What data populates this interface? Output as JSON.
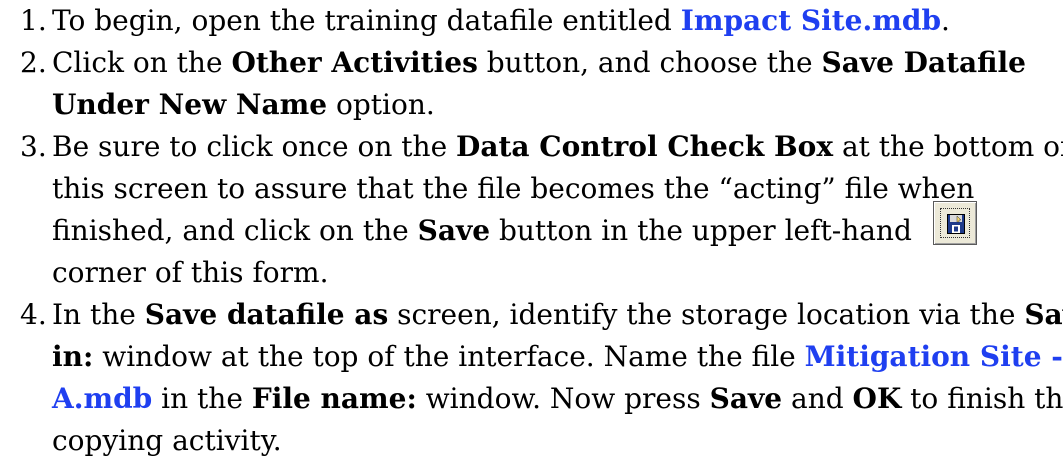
{
  "steps": [
    {
      "num": "1.",
      "lines": [
        {
          "t1": "To begin, open the training datafile entitled ",
          "link1": "Impact Site.mdb",
          "t2": "."
        }
      ]
    },
    {
      "num": "2.",
      "l1": {
        "t1": "Click on the ",
        "b1": "Other Activities",
        "t2": " button, and choose the ",
        "b2": "Save Datafile"
      },
      "l2": {
        "b1": "Under New Name",
        "t1": " option."
      }
    },
    {
      "num": "3.",
      "l1": {
        "t1": "Be sure to click once on the ",
        "b1": "Data Control Check Box",
        "t2": " at the bottom of"
      },
      "l2": {
        "t1": "this screen to assure that the file becomes the “acting” file when"
      },
      "l3": {
        "t1": "finished, and click on the ",
        "b1": "Save",
        "t2": " button in the upper left-hand"
      },
      "l4": {
        "t1": "corner of this form."
      }
    },
    {
      "num": "4.",
      "l1": {
        "t1": "In the ",
        "b1": "Save datafile as",
        "t2": " screen, identify the storage location via the ",
        "b2": "Save"
      },
      "l2": {
        "b1": "in:",
        "t1": " window at the top of the interface. Name the file ",
        "link1": "Mitigation Site -"
      },
      "l3": {
        "link1": "A.mdb",
        "t1": " in the ",
        "b1": "File name:",
        "t2": " window. Now press ",
        "b2": "Save",
        "t3": " and ",
        "b3": "OK",
        "t4": " to finish the"
      },
      "l4": {
        "t1": "copying activity."
      }
    }
  ],
  "icon": {
    "name": "save-floppy-icon",
    "bg": "#ece9d8",
    "accent": "#1e3a8a"
  },
  "colors": {
    "link": "#1f3ff0",
    "text": "#000000"
  }
}
